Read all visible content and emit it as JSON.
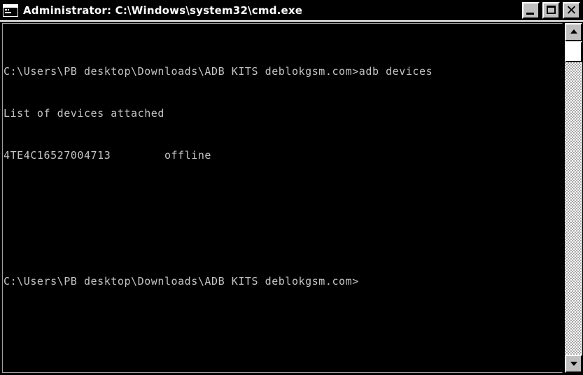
{
  "window": {
    "title": "Administrator: C:\\Windows\\system32\\cmd.exe",
    "icon": "cmd-console-icon",
    "colors": {
      "titlebar_bg": "#000000",
      "titlebar_text": "#ffffff",
      "console_bg": "#000000",
      "console_text": "#c4c4c4",
      "chrome": "#c0c0c0"
    }
  },
  "caption_buttons": {
    "minimize_label": "–",
    "maximize_label": "□",
    "close_label": "✕"
  },
  "console": {
    "lines": [
      "C:\\Users\\PB desktop\\Downloads\\ADB KITS deblokgsm.com>adb devices",
      "List of devices attached",
      "4TE4C16527004713        offline",
      "",
      "C:\\Users\\PB desktop\\Downloads\\ADB KITS deblokgsm.com>"
    ],
    "command": "adb devices",
    "prompt": "C:\\Users\\PB desktop\\Downloads\\ADB KITS deblokgsm.com>",
    "device": {
      "serial": "4TE4C16527004713",
      "state": "offline"
    },
    "output_header": "List of devices attached"
  },
  "scrollbar": {
    "up_arrow": "scroll-up-arrow",
    "down_arrow": "scroll-down-arrow"
  }
}
